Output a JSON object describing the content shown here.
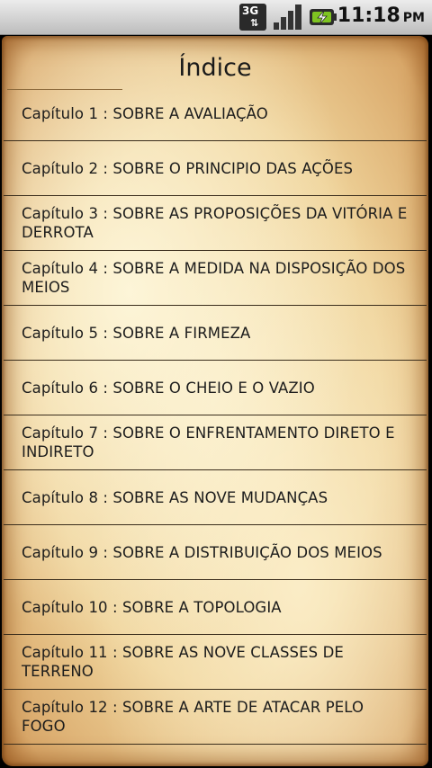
{
  "status": {
    "network": "3G",
    "time": "11:18",
    "ampm": "PM"
  },
  "page": {
    "title": "Índice"
  },
  "chapters": [
    {
      "label": "Capítulo 1 : SOBRE A AVALIAÇÃO"
    },
    {
      "label": "Capítulo 2 : SOBRE O PRINCIPIO DAS AÇÕES"
    },
    {
      "label": "Capítulo 3 : SOBRE AS PROPOSIÇÕES DA VITÓRIA E DERROTA"
    },
    {
      "label": "Capítulo 4 : SOBRE A MEDIDA NA DISPOSIÇÃO DOS MEIOS"
    },
    {
      "label": "Capítulo 5 : SOBRE A FIRMEZA"
    },
    {
      "label": "Capítulo 6 : SOBRE O CHEIO E O VAZIO"
    },
    {
      "label": "Capítulo 7 : SOBRE O ENFRENTAMENTO DIRETO E INDIRETO"
    },
    {
      "label": "Capítulo 8 : SOBRE AS NOVE MUDANÇAS"
    },
    {
      "label": "Capítulo 9 : SOBRE A DISTRIBUIÇÃO DOS MEIOS"
    },
    {
      "label": "Capítulo 10 : SOBRE A TOPOLOGIA"
    },
    {
      "label": "Capítulo 11 : SOBRE AS NOVE CLASSES DE TERRENO"
    },
    {
      "label": "Capítulo 12 : SOBRE A ARTE DE ATACAR PELO FOGO"
    }
  ]
}
